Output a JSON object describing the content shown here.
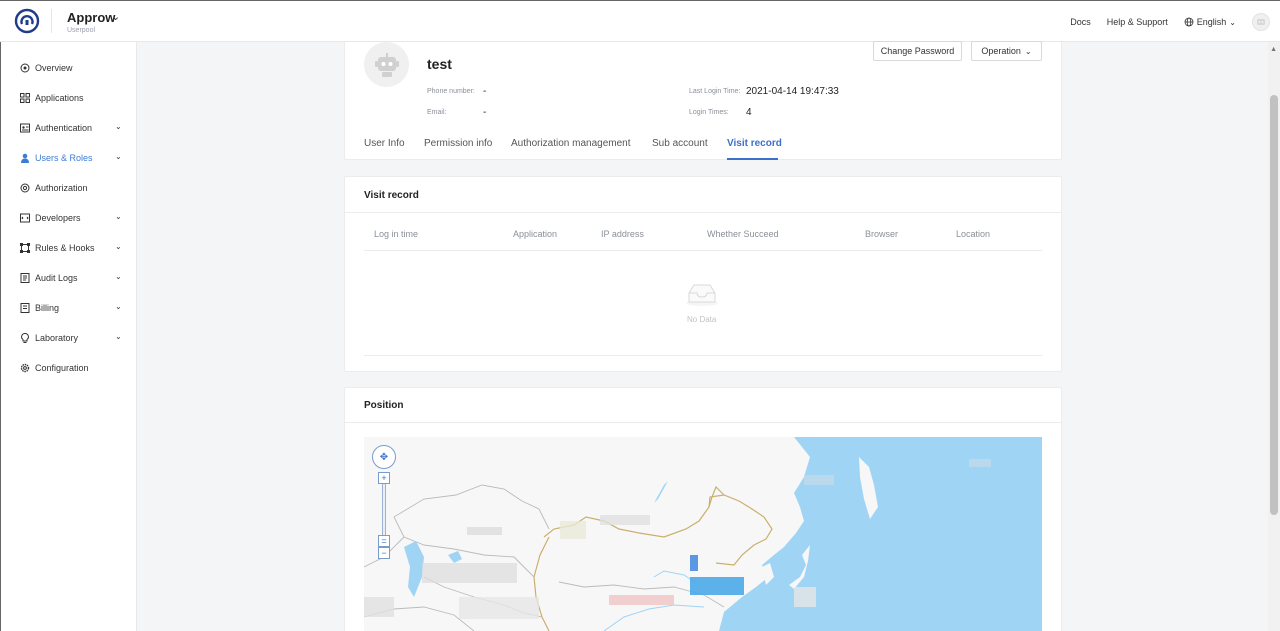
{
  "header": {
    "app_name": "Approw",
    "app_sub": "Userpool",
    "docs": "Docs",
    "help": "Help & Support",
    "language": "English"
  },
  "sidebar": {
    "items": [
      {
        "label": "Overview",
        "icon": "overview-icon",
        "expandable": false
      },
      {
        "label": "Applications",
        "icon": "grid-icon",
        "expandable": false
      },
      {
        "label": "Authentication",
        "icon": "id-card-icon",
        "expandable": true
      },
      {
        "label": "Users & Roles",
        "icon": "user-icon",
        "expandable": true,
        "active": true
      },
      {
        "label": "Authorization",
        "icon": "lock-icon",
        "expandable": false
      },
      {
        "label": "Developers",
        "icon": "code-icon",
        "expandable": true
      },
      {
        "label": "Rules & Hooks",
        "icon": "hook-icon",
        "expandable": true
      },
      {
        "label": "Audit Logs",
        "icon": "log-icon",
        "expandable": true
      },
      {
        "label": "Billing",
        "icon": "billing-icon",
        "expandable": true
      },
      {
        "label": "Laboratory",
        "icon": "bulb-icon",
        "expandable": true
      },
      {
        "label": "Configuration",
        "icon": "gear-icon",
        "expandable": false
      }
    ]
  },
  "profile": {
    "name": "test",
    "phone_label": "Phone number:",
    "phone_value": "-",
    "email_label": "Email:",
    "email_value": "-",
    "last_login_label": "Last Login Time:",
    "last_login_value": "2021-04-14 19:47:33",
    "login_times_label": "Login Times:",
    "login_times_value": "4",
    "change_password": "Change Password",
    "operation": "Operation"
  },
  "tabs": [
    "User Info",
    "Permission info",
    "Authorization management",
    "Sub account",
    "Visit record"
  ],
  "active_tab": "Visit record",
  "visit_record": {
    "title": "Visit record",
    "columns": [
      "Log in time",
      "Application",
      "IP address",
      "Whether Succeed",
      "Browser",
      "Location"
    ],
    "empty_text": "No Data"
  },
  "position": {
    "title": "Position"
  },
  "colors": {
    "accent": "#3b6fc9",
    "water": "#9fd4f5"
  }
}
